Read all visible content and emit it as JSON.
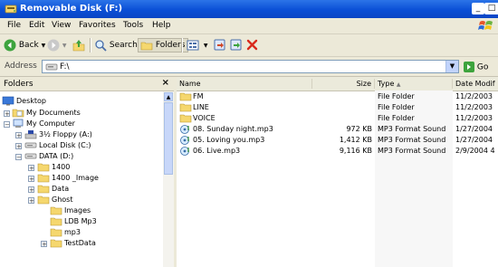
{
  "window": {
    "title": "Removable Disk (F:)",
    "controls": {
      "minimize": "_",
      "maximize": "□"
    }
  },
  "menu": [
    "File",
    "Edit",
    "View",
    "Favorites",
    "Tools",
    "Help"
  ],
  "toolbar": {
    "back": "Back",
    "search": "Search",
    "folders": "Folders"
  },
  "address": {
    "label": "Address",
    "value": "F:\\",
    "go": "Go"
  },
  "folders_pane": {
    "title": "Folders",
    "close": "×",
    "tree": [
      {
        "label": "Desktop",
        "icon": "desktop-icon",
        "expander": ""
      },
      {
        "label": "My Documents",
        "icon": "my-documents-icon",
        "expander": "+"
      },
      {
        "label": "My Computer",
        "icon": "my-computer-icon",
        "expander": "−"
      },
      {
        "label": "3½ Floppy (A:)",
        "icon": "floppy-icon",
        "expander": "+"
      },
      {
        "label": "Local Disk (C:)",
        "icon": "drive-icon",
        "expander": "+"
      },
      {
        "label": "DATA (D:)",
        "icon": "drive-icon",
        "expander": "−"
      },
      {
        "label": "1400",
        "icon": "folder-icon",
        "expander": "+"
      },
      {
        "label": "1400 _Image",
        "icon": "folder-icon",
        "expander": "+"
      },
      {
        "label": "Data",
        "icon": "folder-icon",
        "expander": "+"
      },
      {
        "label": "Ghost",
        "icon": "folder-icon",
        "expander": "+"
      },
      {
        "label": "Images",
        "icon": "folder-icon",
        "expander": ""
      },
      {
        "label": "LDB Mp3",
        "icon": "folder-icon",
        "expander": ""
      },
      {
        "label": "mp3",
        "icon": "folder-icon",
        "expander": ""
      },
      {
        "label": "TestData",
        "icon": "folder-icon",
        "expander": "+"
      }
    ]
  },
  "columns": {
    "name": "Name",
    "size": "Size",
    "type": "Type",
    "type_sort": "▲",
    "date": "Date Modif"
  },
  "files": [
    {
      "name": "FM",
      "size": "",
      "type": "File Folder",
      "date": "11/2/2003",
      "icon": "folder-icon"
    },
    {
      "name": "LINE",
      "size": "",
      "type": "File Folder",
      "date": "11/2/2003",
      "icon": "folder-icon"
    },
    {
      "name": "VOICE",
      "size": "",
      "type": "File Folder",
      "date": "11/2/2003",
      "icon": "folder-icon"
    },
    {
      "name": "08. Sunday night.mp3",
      "size": "972 KB",
      "type": "MP3 Format Sound",
      "date": "1/27/2004",
      "icon": "mp3-icon"
    },
    {
      "name": "05. Loving you.mp3",
      "size": "1,412 KB",
      "type": "MP3 Format Sound",
      "date": "1/27/2004",
      "icon": "mp3-icon"
    },
    {
      "name": "06. Live.mp3",
      "size": "9,116 KB",
      "type": "MP3 Format Sound",
      "date": "2/9/2004 4",
      "icon": "mp3-icon"
    }
  ]
}
